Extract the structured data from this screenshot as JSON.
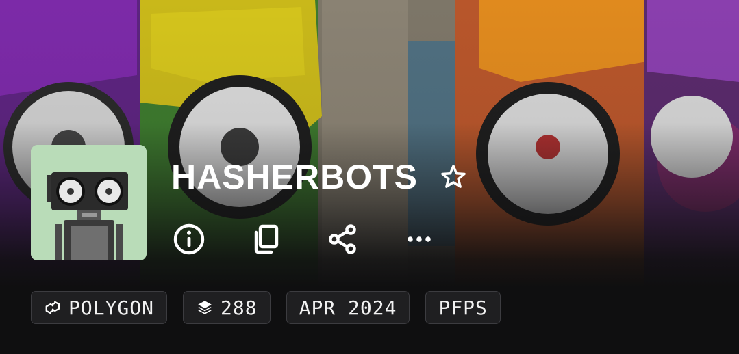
{
  "collection": {
    "name": "HASHERBOTS"
  },
  "actions": [
    {
      "name": "info-icon"
    },
    {
      "name": "copy-icon"
    },
    {
      "name": "share-icon"
    },
    {
      "name": "more-icon"
    }
  ],
  "tags": {
    "chain": "POLYGON",
    "items": "288",
    "date": "APR 2024",
    "category": "PFPS"
  },
  "icons": {
    "favorite": "star-outline-icon",
    "chain": "polygon-icon",
    "items": "layers-icon"
  },
  "colors": {
    "background": "#0f0f10",
    "tag_bg": "#1f1f21",
    "tag_border": "#3c3c40",
    "avatar_bg": "#b9dcb8",
    "banner_purple": "#7c2aa8",
    "banner_yellow": "#d4c41c",
    "banner_green": "#4fa63a",
    "banner_orange": "#e0773a"
  }
}
